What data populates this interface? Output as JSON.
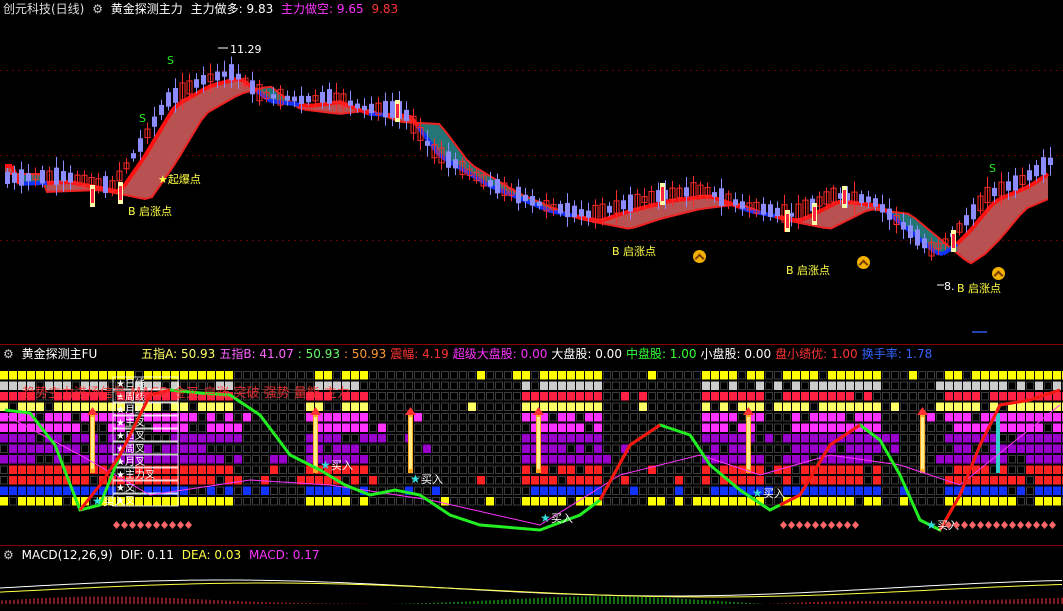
{
  "colors": {
    "up": "#ff2a2a",
    "down": "#8c8cff",
    "bg": "#000000",
    "yellow": "#ffff00",
    "green": "#22ee22",
    "magenta": "#ff33ff",
    "cyan": "#33dddd"
  },
  "main": {
    "stock": "创元科技(日线)",
    "indicator": "黄金探测主力",
    "long_label": "主力做多: ",
    "long_value": "9.83",
    "short_label": "主力做空: ",
    "short_value": "9.65",
    "extra_value": "9.83",
    "high_label": "11.29",
    "low_label": "8.",
    "signals": {
      "s": "S",
      "boom": "起爆点",
      "rise": "启涨点",
      "b_rise": "B 启涨点"
    },
    "markers": {
      "dollar": "$",
      "cai": "财"
    }
  },
  "sub": {
    "name": "黄金探测主FU",
    "items": [
      {
        "label": "五指A: ",
        "value": "50.93",
        "color": "#ffff66"
      },
      {
        "label": "五指B: ",
        "value": "41.07",
        "color": "#ff66ff"
      },
      {
        "label": "",
        "value": ": 50.93",
        "color": "#66ff66"
      },
      {
        "label": "",
        "value": ": 50.93",
        "color": "#ff9933"
      },
      {
        "label": "震幅: ",
        "value": "4.19",
        "color": "#ff3333"
      },
      {
        "label": "超级大盘股: ",
        "value": "0.00",
        "color": "#ff33ff"
      },
      {
        "label": "大盘股: ",
        "value": "0.00",
        "color": "#ffffff"
      },
      {
        "label": "中盘股: ",
        "value": "1.00",
        "color": "#33ff33"
      },
      {
        "label": "小盘股: ",
        "value": "0.00",
        "color": "#ffffff"
      },
      {
        "label": "盘小绩优: ",
        "value": "1.00",
        "color": "#ff3333"
      },
      {
        "label": "换手率: ",
        "value": "1.78",
        "color": "#3366ff"
      }
    ],
    "buy": "买入",
    "overlay": "趋势主力进场信号 MACD 金叉 启涨 突破 强势 量能 主力",
    "column_words": [
      "日线",
      "周线",
      "月线",
      "主叉",
      "日叉",
      "周叉",
      "月叉",
      "主力叉",
      "文",
      "叉"
    ]
  },
  "macd": {
    "name": "MACD(12,26,9)",
    "dif_label": "DIF: ",
    "dif": "0.11",
    "dea_label": "DEA: ",
    "dea": "0.03",
    "macd_label": "MACD: ",
    "macd": "0.17"
  }
}
